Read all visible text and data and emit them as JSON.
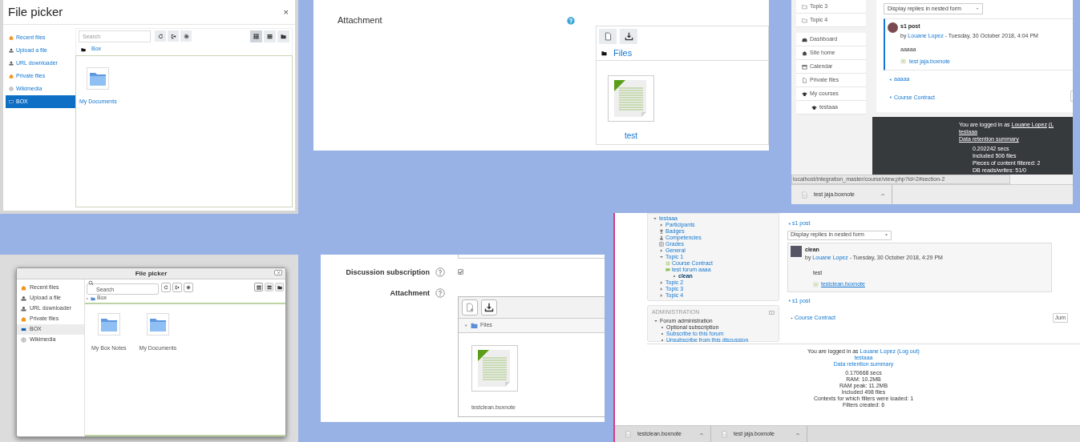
{
  "file_pickers": [
    {
      "kind": "boost",
      "title": "File picker",
      "close": "×",
      "repositories": [
        {
          "label": "Recent files",
          "kind": "recent",
          "selected": false
        },
        {
          "label": "Upload a file",
          "kind": "upload",
          "selected": false
        },
        {
          "label": "URL downloader",
          "kind": "url",
          "selected": false
        },
        {
          "label": "Private files",
          "kind": "private",
          "selected": false
        },
        {
          "label": "Wikimedia",
          "kind": "wiki",
          "selected": false
        },
        {
          "label": "BOX",
          "kind": "box",
          "selected": true
        }
      ],
      "search": {
        "placeholder": "Search"
      },
      "view_modes": [
        {
          "kind": "icons",
          "selected": true
        },
        {
          "kind": "list",
          "selected": false
        },
        {
          "kind": "tree",
          "selected": false
        }
      ],
      "path": [
        "Box"
      ],
      "items": [
        {
          "label": "My Documents"
        }
      ]
    },
    {
      "kind": "clean",
      "title": "File picker",
      "repositories": [
        {
          "label": "Recent files",
          "kind": "recent",
          "selected": false
        },
        {
          "label": "Upload a file",
          "kind": "upload",
          "selected": false
        },
        {
          "label": "URL downloader",
          "kind": "url",
          "selected": false
        },
        {
          "label": "Private files",
          "kind": "private",
          "selected": false
        },
        {
          "label": "BOX",
          "kind": "box",
          "selected": true
        },
        {
          "label": "Wikimedia",
          "kind": "wiki",
          "selected": false
        }
      ],
      "search": {
        "placeholder": "Search"
      },
      "view_modes": [
        {
          "kind": "icons",
          "selected": true
        },
        {
          "kind": "list",
          "selected": false
        },
        {
          "kind": "tree",
          "selected": false
        }
      ],
      "path": [
        "Box"
      ],
      "items": [
        {
          "label": "My Box Notes"
        },
        {
          "label": "My Documents"
        }
      ]
    }
  ],
  "attachment_forms": [
    {
      "kind": "boost",
      "fields": [
        {
          "kind": "filemanager",
          "label": "Attachment",
          "path": "Files",
          "files": [
            {
              "name": "test"
            }
          ]
        }
      ]
    },
    {
      "kind": "clean",
      "fields": [
        {
          "kind": "checkbox",
          "label": "Discussion subscription",
          "checked": true
        },
        {
          "kind": "filemanager",
          "label": "Attachment",
          "path": "Files",
          "files": [
            {
              "name": "testclean.boxnote"
            }
          ]
        }
      ]
    }
  ],
  "forum_pages": [
    {
      "kind": "boost",
      "nav_groups": [
        [
          {
            "label": "Topic 3",
            "kind": "folder"
          },
          {
            "label": "Topic 4",
            "kind": "folder"
          }
        ],
        [
          {
            "label": "Dashboard",
            "kind": "dashboard"
          },
          {
            "label": "Site home",
            "kind": "home"
          },
          {
            "label": "Calendar",
            "kind": "calendar"
          },
          {
            "label": "Private files",
            "kind": "file"
          },
          {
            "label": "My courses",
            "kind": "courses",
            "children": [
              {
                "label": "testaaa",
                "kind": "courses"
              }
            ]
          }
        ]
      ],
      "display_mode": "Display replies in nested form",
      "post": {
        "subject": "s1 post",
        "by": "by",
        "author": "Louane Lopez",
        "date": "- Tuesday, 30 October 2018, 4:04 PM",
        "message": "aaaaa",
        "attachment": "test jaja.boxnote"
      },
      "prev_link": "aaaaa",
      "course_link": "Course Contract",
      "footer": {
        "prefix": "You are logged in as",
        "user": "Louane Lopez",
        "suffix": "(L",
        "lines": [
          {
            "text": "testaaa",
            "kind": "link"
          },
          {
            "text": "Data retention summary",
            "kind": "link"
          },
          {
            "text": "0.202242 secs",
            "kind": "stat"
          },
          {
            "text": "Included 506 files",
            "kind": "stat"
          },
          {
            "text": "Pieces of content filtered: 2",
            "kind": "stat"
          },
          {
            "text": "DB reads/writes: 51/0",
            "kind": "stat"
          }
        ]
      },
      "status_url": "localhost/integration_master/course/view.php?id=2#section-2",
      "downloads": [
        {
          "name": "test jaja.boxnote"
        }
      ]
    },
    {
      "kind": "clean",
      "tree": [
        {
          "label": "testaaa",
          "kind": "branch",
          "expanded": true,
          "children": [
            {
              "label": "Participants",
              "kind": "branch",
              "expanded": false
            },
            {
              "label": "Badges",
              "kind": "badge"
            },
            {
              "label": "Competencies",
              "kind": "competency"
            },
            {
              "label": "Grades",
              "kind": "grades"
            },
            {
              "label": "General",
              "kind": "branch",
              "expanded": false
            },
            {
              "label": "Topic 1",
              "kind": "branch",
              "expanded": true,
              "children": [
                {
                  "label": "Course Contract",
                  "kind": "page"
                },
                {
                  "label": "test forum aaaa",
                  "kind": "forum",
                  "children": [
                    {
                      "label": "clean",
                      "kind": "item",
                      "current": true
                    }
                  ]
                }
              ]
            },
            {
              "label": "Topic 2",
              "kind": "branch",
              "expanded": false
            },
            {
              "label": "Topic 3",
              "kind": "branch",
              "expanded": false
            },
            {
              "label": "Topic 4",
              "kind": "branch",
              "expanded": false
            }
          ]
        }
      ],
      "administration": {
        "title": "ADMINISTRATION",
        "items": [
          {
            "label": "Forum administration",
            "kind": "branch",
            "expanded": true,
            "children": [
              {
                "label": "Optional subscription",
                "kind": "text"
              },
              {
                "label": "Subscribe to this forum",
                "kind": "link"
              },
              {
                "label": "Unsubscribe from this discussion",
                "kind": "link"
              }
            ]
          }
        ]
      },
      "top_link": "s1 post",
      "display_mode": "Display replies in nested form",
      "post": {
        "subject": "clean",
        "by": "by",
        "author": "Louane Lopez",
        "date": "- Tuesday, 30 October 2018, 4:29 PM",
        "message": "test",
        "attachment": "testclean.boxnote"
      },
      "bottom_link": "s1 post",
      "course_link": "Course Contract",
      "jump": "Jum",
      "footer": {
        "prefix": "You are logged in as",
        "user": "Louane Lopez",
        "suffix": "(Log out)",
        "lines": [
          {
            "text": "testaaa",
            "kind": "link"
          },
          {
            "text": "Data retention summary",
            "kind": "link"
          },
          {
            "text": "0.170668 secs",
            "kind": "stat"
          },
          {
            "text": "RAM: 10.2MB",
            "kind": "stat"
          },
          {
            "text": "RAM peak: 11.2MB",
            "kind": "stat"
          },
          {
            "text": "Included 498 files",
            "kind": "stat"
          },
          {
            "text": "Contexts for which filters were loaded: 1",
            "kind": "stat"
          },
          {
            "text": "Filters created: 6",
            "kind": "stat"
          }
        ]
      },
      "downloads": [
        {
          "name": "testclean.boxnote"
        },
        {
          "name": "test jaja.boxnote"
        }
      ]
    }
  ]
}
